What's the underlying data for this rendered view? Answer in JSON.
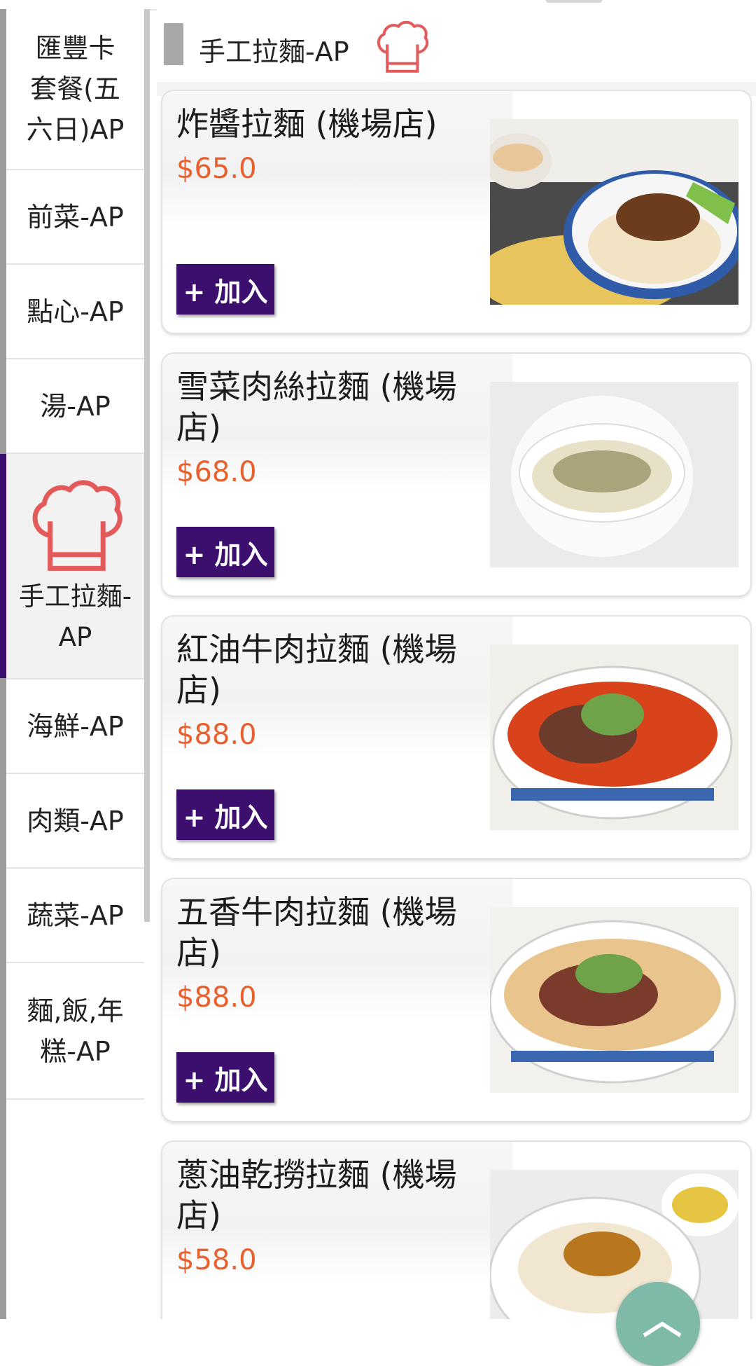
{
  "sidebar": {
    "categories": [
      {
        "label": "匯豐卡套餐(五六日)AP"
      },
      {
        "label": "前菜-AP"
      },
      {
        "label": "點心-AP"
      },
      {
        "label": "湯-AP"
      },
      {
        "label": "手工拉麵-AP",
        "active": true
      },
      {
        "label": "海鮮-AP"
      },
      {
        "label": "肉類-AP"
      },
      {
        "label": "蔬菜-AP"
      },
      {
        "label": "麵,飯,年糕-AP"
      }
    ]
  },
  "section": {
    "title": "手工拉麵-AP",
    "icon": "chef-hat-icon"
  },
  "add_label": "+ 加入",
  "menu_items": [
    {
      "name": "炸醬拉麵 (機場店)",
      "price": "$65.0"
    },
    {
      "name": "雪菜肉絲拉麵 (機場店)",
      "price": "$68.0"
    },
    {
      "name": "紅油牛肉拉麵 (機場店)",
      "price": "$88.0"
    },
    {
      "name": "五香牛肉拉麵 (機場店)",
      "price": "$88.0"
    },
    {
      "name": "蔥油乾撈拉麵 (機場店)",
      "price": "$58.0"
    }
  ],
  "colors": {
    "accent": "#3c0f6e",
    "price": "#e8602d",
    "chef_icon": "#e45a5a"
  }
}
